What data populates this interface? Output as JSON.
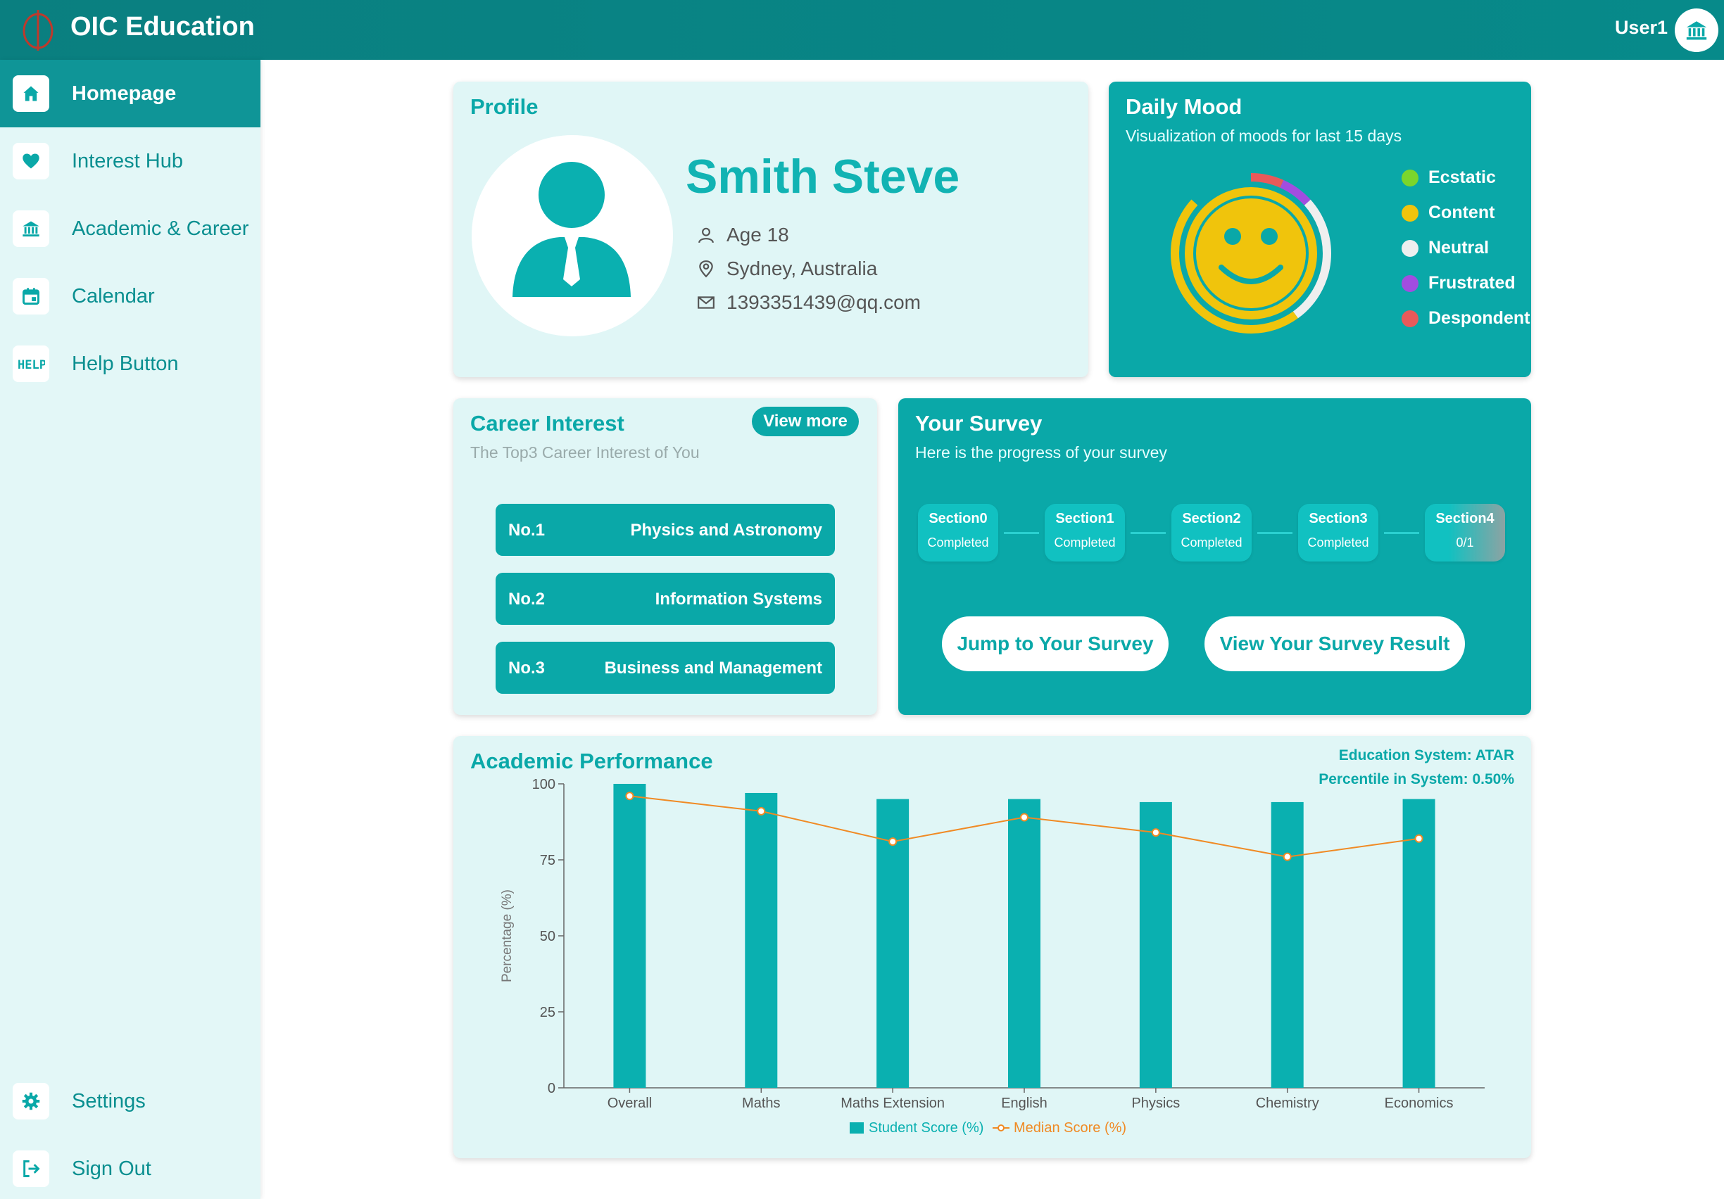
{
  "header": {
    "brand": "OIC Education",
    "user": "User1"
  },
  "sidebar": {
    "items": [
      {
        "label": "Homepage",
        "icon": "home-icon",
        "active": true
      },
      {
        "label": "Interest Hub",
        "icon": "heart-icon"
      },
      {
        "label": "Academic & Career",
        "icon": "bank-icon"
      },
      {
        "label": "Calendar",
        "icon": "calendar-icon"
      },
      {
        "label": "Help Button",
        "icon": "help-icon"
      }
    ],
    "bottom": [
      {
        "label": "Settings",
        "icon": "gear-icon"
      },
      {
        "label": "Sign Out",
        "icon": "sign-out-icon"
      }
    ]
  },
  "profile": {
    "title": "Profile",
    "name": "Smith Steve",
    "age": "Age 18",
    "location": "Sydney, Australia",
    "email": "1393351439@qq.com"
  },
  "mood": {
    "title": "Daily Mood",
    "subtitle": "Visualization of moods for last 15 days",
    "legend": [
      {
        "label": "Ecstatic",
        "color": "#7bd62c"
      },
      {
        "label": "Content",
        "color": "#f0c40c"
      },
      {
        "label": "Neutral",
        "color": "#efefef"
      },
      {
        "label": "Frustrated",
        "color": "#a24de0"
      },
      {
        "label": "Despondent",
        "color": "#e85a5a"
      }
    ]
  },
  "career": {
    "title": "Career Interest",
    "subtitle": "The Top3 Career Interest of You",
    "view_more": "View more",
    "ranks": [
      {
        "no": "No.1",
        "field": "Physics and Astronomy"
      },
      {
        "no": "No.2",
        "field": "Information Systems"
      },
      {
        "no": "No.3",
        "field": "Business and Management"
      }
    ]
  },
  "survey": {
    "title": "Your Survey",
    "subtitle": "Here is the progress of your survey",
    "steps": [
      {
        "name": "Section0",
        "status": "Completed"
      },
      {
        "name": "Section1",
        "status": "Completed"
      },
      {
        "name": "Section2",
        "status": "Completed"
      },
      {
        "name": "Section3",
        "status": "Completed"
      },
      {
        "name": "Section4",
        "status": "0/1"
      }
    ],
    "jump_label": "Jump to Your Survey",
    "result_label": "View Your Survey Result"
  },
  "academic": {
    "title": "Academic Performance",
    "system": "Education System: ATAR",
    "percentile": "Percentile in System: 0.50%"
  },
  "chart_data": {
    "type": "bar",
    "categories": [
      "Overall",
      "Maths",
      "Maths Extension",
      "English",
      "Physics",
      "Chemistry",
      "Economics"
    ],
    "series": [
      {
        "name": "Student Score (%)",
        "type": "bar",
        "color": "#0ab0b0",
        "values": [
          100,
          97,
          95,
          95,
          94,
          94,
          95
        ]
      },
      {
        "name": "Median Score (%)",
        "type": "line",
        "color": "#f08a24",
        "values": [
          96,
          91,
          81,
          89,
          84,
          76,
          82
        ]
      }
    ],
    "ylabel": "Percentage (%)",
    "ylim": [
      0,
      100
    ],
    "yticks": [
      0,
      25,
      50,
      75,
      100
    ],
    "legend": "bottom"
  }
}
